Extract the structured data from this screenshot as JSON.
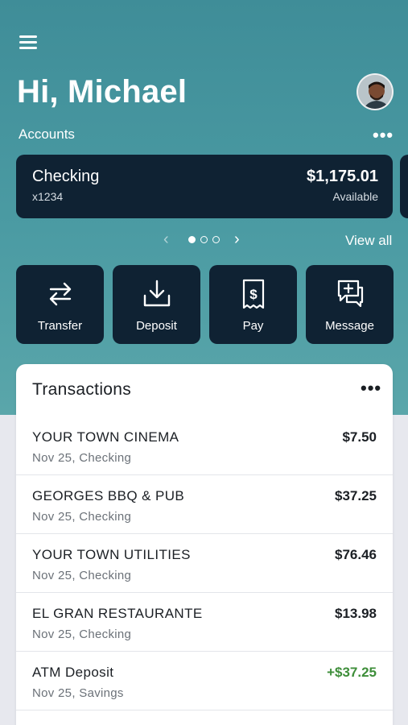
{
  "header": {
    "greeting": "Hi, Michael",
    "menu_icon": "hamburger-menu-icon",
    "avatar_icon": "user-avatar"
  },
  "accounts": {
    "label": "Accounts",
    "more_label": "•••",
    "card": {
      "name": "Checking",
      "number": "x1234",
      "balance": "$1,175.01",
      "balance_label": "Available"
    },
    "pager": {
      "total": 3,
      "active_index": 0,
      "prev_icon": "chevron-left-icon",
      "next_icon": "chevron-right-icon"
    },
    "view_all": "View all"
  },
  "actions": [
    {
      "label": "Transfer",
      "icon": "transfer-arrows-icon"
    },
    {
      "label": "Deposit",
      "icon": "deposit-download-icon"
    },
    {
      "label": "Pay",
      "icon": "pay-receipt-icon"
    },
    {
      "label": "Message",
      "icon": "message-add-icon"
    }
  ],
  "transactions": {
    "title": "Transactions",
    "more_label": "•••",
    "items": [
      {
        "name": "YOUR TOWN CINEMA",
        "meta": "Nov 25, Checking",
        "amount": "$7.50",
        "type": "debit"
      },
      {
        "name": "GEORGES BBQ & PUB",
        "meta": "Nov 25, Checking",
        "amount": "$37.25",
        "type": "debit"
      },
      {
        "name": "YOUR TOWN UTILITIES",
        "meta": "Nov 25, Checking",
        "amount": "$76.46",
        "type": "debit"
      },
      {
        "name": "EL GRAN RESTAURANTE",
        "meta": "Nov 25, Checking",
        "amount": "$13.98",
        "type": "debit"
      },
      {
        "name": "ATM Deposit",
        "meta": "Nov 25, Savings",
        "amount": "+$37.25",
        "type": "credit"
      }
    ]
  },
  "colors": {
    "hero_teal": "#4b9ba3",
    "card_navy": "#0f2233",
    "credit_green": "#3e8e3a"
  }
}
